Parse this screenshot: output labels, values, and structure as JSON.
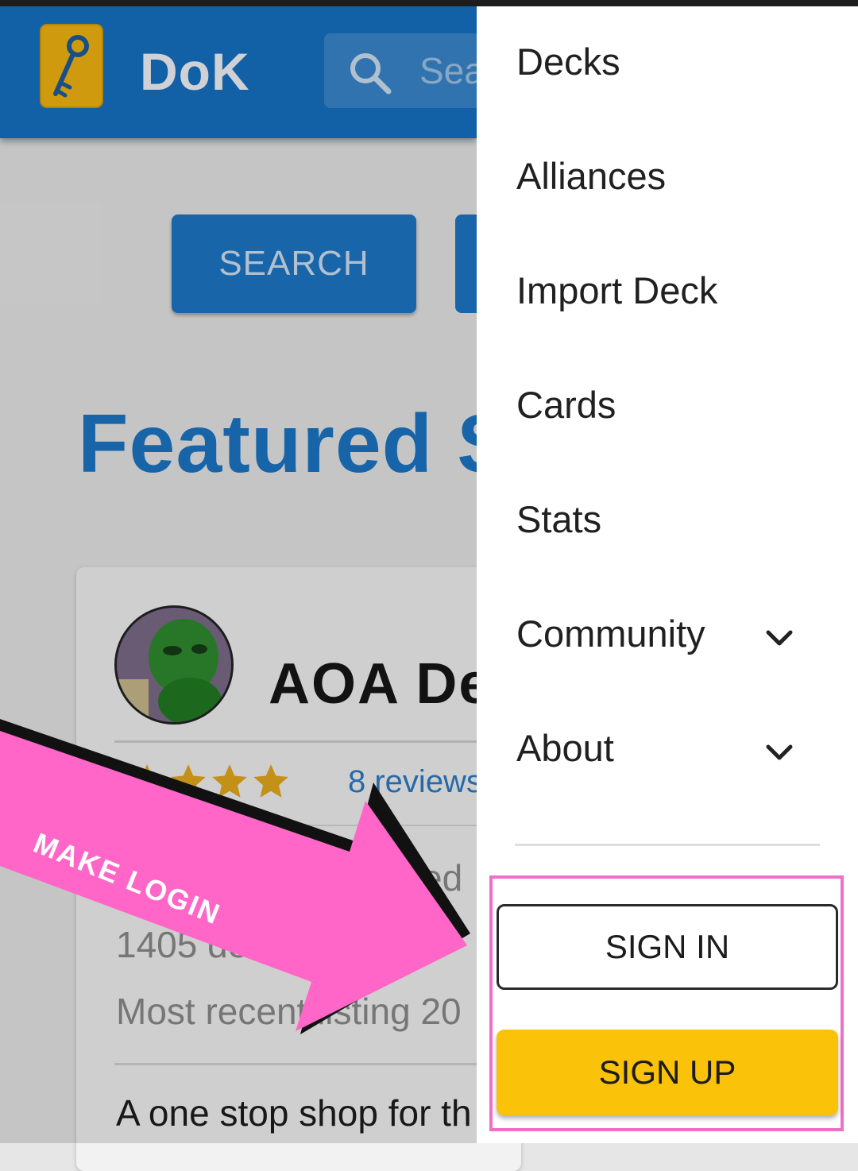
{
  "app": {
    "brand": "DoK"
  },
  "search": {
    "placeholder": "Search"
  },
  "page": {
    "search_button": "SEARCH",
    "featured_heading": "Featured S",
    "card": {
      "title": "AOA De",
      "rating": {
        "stars_shown": 4
      },
      "reviews_link": "8 reviews",
      "line_tail": "ited",
      "line_count": "1405 de",
      "line_recent": "Most recent listing 20",
      "description": "A one stop shop for th"
    }
  },
  "annotation": {
    "label": "MAKE LOGIN",
    "color": "#ff66c8"
  },
  "drawer": {
    "items": [
      {
        "label": "Decks"
      },
      {
        "label": "Alliances"
      },
      {
        "label": "Import Deck"
      },
      {
        "label": "Cards"
      },
      {
        "label": "Stats"
      },
      {
        "label": "Community",
        "expandable": true
      },
      {
        "label": "About",
        "expandable": true
      }
    ],
    "sign_in": "SIGN IN",
    "sign_up": "SIGN UP"
  },
  "colors": {
    "app_bar": "#1670c0",
    "accent_yellow": "#fac208",
    "highlight_pink": "#ee6fc8",
    "link_blue": "#2e7bc4"
  }
}
